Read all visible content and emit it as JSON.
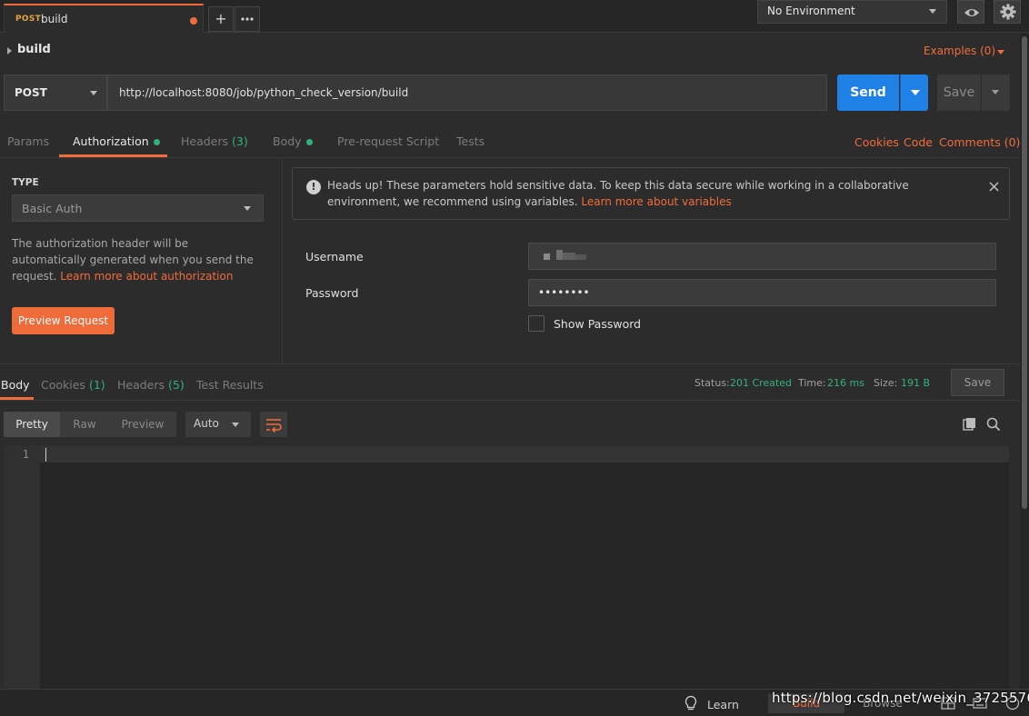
{
  "tab": {
    "method": "POST",
    "title": "build"
  },
  "environment": {
    "selected": "No Environment"
  },
  "request": {
    "name": "build",
    "examples_label": "Examples (0)",
    "method": "POST",
    "url": "http://localhost:8080/job/python_check_version/build"
  },
  "actions": {
    "send": "Send",
    "save": "Save"
  },
  "request_tabs": {
    "params": "Params",
    "authorization": "Authorization",
    "headers": "Headers",
    "headers_count": "(3)",
    "body": "Body",
    "prerequest": "Pre-request Script",
    "tests": "Tests",
    "cookies": "Cookies",
    "code": "Code",
    "comments": "Comments (0)"
  },
  "auth": {
    "type_label": "TYPE",
    "type_value": "Basic Auth",
    "desc_text": "The authorization header will be automatically generated when you send the request. ",
    "desc_link": "Learn more about authorization",
    "preview_button": "Preview Request",
    "notice_text": "Heads up! These parameters hold sensitive data. To keep this data secure while working in a collaborative environment, we recommend using variables. ",
    "notice_link": "Learn more about variables",
    "username_label": "Username",
    "password_label": "Password",
    "password_value": "••••••••",
    "show_password_label": "Show Password"
  },
  "response": {
    "tabs": {
      "body": "Body",
      "cookies": "Cookies",
      "cookies_count": "(1)",
      "headers": "Headers",
      "headers_count": "(5)",
      "test_results": "Test Results"
    },
    "status_label": "Status:",
    "status_value": "201 Created",
    "time_label": "Time:",
    "time_value": "216 ms",
    "size_label": "Size:",
    "size_value": "191 B",
    "save": "Save",
    "view_modes": {
      "pretty": "Pretty",
      "raw": "Raw",
      "preview": "Preview"
    },
    "format": "Auto",
    "line_number": "1"
  },
  "statusbar": {
    "learn": "Learn",
    "build": "Build",
    "browse": "Browse"
  },
  "watermark": "https://blog.csdn.net/weixin_37255769",
  "colors": {
    "accent": "#f26b3a",
    "send": "#1f80e6",
    "success": "#2fb37e"
  }
}
